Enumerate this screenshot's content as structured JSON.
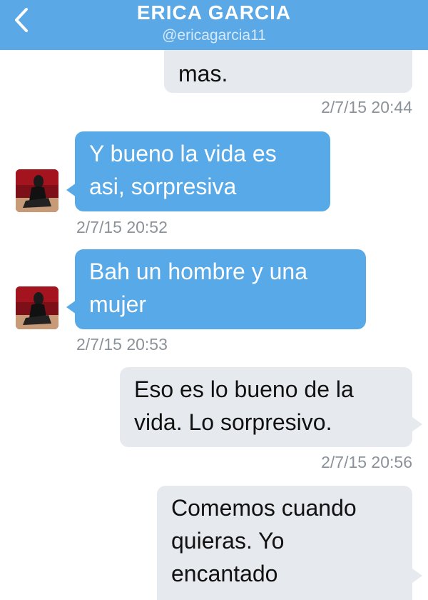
{
  "header": {
    "back_icon": "chevron-left-icon",
    "name": "ERICA GARCIA",
    "handle": "@ericagarcia11"
  },
  "colors": {
    "header": "#5aa8e6",
    "incoming_bubble": "#58a9e8",
    "outgoing_bubble": "#e6e9ed",
    "timestamp": "#8b9299"
  },
  "messages": [
    {
      "direction": "outgoing",
      "lines": [
        "mas."
      ],
      "time": "2/7/15 20:44"
    },
    {
      "direction": "incoming",
      "lines": [
        "Y bueno la vida es",
        "asi, sorpresiva"
      ],
      "time": "2/7/15 20:52"
    },
    {
      "direction": "incoming",
      "lines": [
        "Bah un hombre y una",
        "mujer"
      ],
      "time": "2/7/15 20:53"
    },
    {
      "direction": "outgoing",
      "lines": [
        "Eso es lo bueno de la",
        "vida. Lo sorpresivo."
      ],
      "time": "2/7/15 20:56"
    },
    {
      "direction": "outgoing",
      "lines": [
        "Comemos cuando",
        "quieras. Yo",
        "encantado"
      ],
      "time": ""
    }
  ]
}
